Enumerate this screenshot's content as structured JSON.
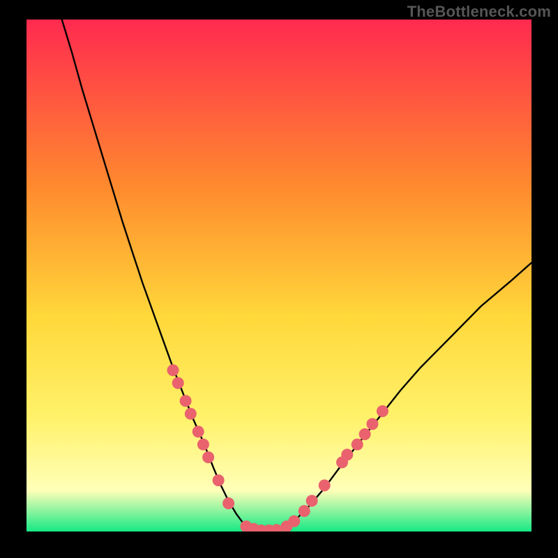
{
  "attribution": "TheBottleneck.com",
  "colors": {
    "gradient_top": "#ff2a4f",
    "gradient_upper_mid": "#ff8b2e",
    "gradient_mid": "#ffd83a",
    "gradient_lower_mid": "#fff26b",
    "gradient_cream": "#ffffb8",
    "gradient_green": "#17e885",
    "curve": "#000000",
    "dot": "#e9626e",
    "frame": "#000000"
  },
  "chart_data": {
    "type": "line",
    "title": "",
    "xlabel": "",
    "ylabel": "",
    "xlim": [
      0,
      100
    ],
    "ylim": [
      0,
      100
    ],
    "series": [
      {
        "name": "bottleneck-curve",
        "x": [
          7.0,
          9.0,
          11.0,
          13.0,
          15.0,
          17.0,
          19.0,
          21.0,
          23.0,
          25.0,
          27.0,
          29.0,
          31.0,
          33.0,
          35.0,
          37.0,
          38.5,
          40.0,
          41.5,
          43.0,
          44.5,
          46.0,
          48.0,
          50.0,
          53.0,
          56.0,
          59.0,
          62.0,
          66.0,
          70.0,
          74.0,
          78.0,
          84.0,
          90.0,
          96.0,
          100.0
        ],
        "y": [
          100.0,
          93.5,
          86.5,
          80.0,
          73.5,
          67.0,
          60.5,
          54.5,
          48.5,
          43.0,
          37.5,
          32.0,
          27.0,
          22.0,
          17.5,
          12.5,
          9.0,
          6.0,
          3.5,
          1.5,
          0.5,
          0.2,
          0.2,
          0.5,
          2.0,
          5.0,
          8.5,
          12.5,
          17.5,
          22.5,
          27.5,
          32.0,
          38.0,
          44.0,
          49.0,
          52.5
        ]
      }
    ],
    "scatter_overlay": {
      "name": "highlight-dots",
      "points": [
        {
          "x": 29.0,
          "y": 31.5
        },
        {
          "x": 30.0,
          "y": 29.0
        },
        {
          "x": 31.5,
          "y": 25.5
        },
        {
          "x": 32.5,
          "y": 23.0
        },
        {
          "x": 34.0,
          "y": 19.5
        },
        {
          "x": 35.0,
          "y": 17.0
        },
        {
          "x": 36.0,
          "y": 14.5
        },
        {
          "x": 38.0,
          "y": 10.0
        },
        {
          "x": 40.0,
          "y": 5.5
        },
        {
          "x": 43.5,
          "y": 1.0
        },
        {
          "x": 45.0,
          "y": 0.5
        },
        {
          "x": 46.5,
          "y": 0.2
        },
        {
          "x": 48.0,
          "y": 0.2
        },
        {
          "x": 49.5,
          "y": 0.3
        },
        {
          "x": 51.5,
          "y": 1.0
        },
        {
          "x": 53.0,
          "y": 2.0
        },
        {
          "x": 55.0,
          "y": 4.0
        },
        {
          "x": 56.5,
          "y": 6.0
        },
        {
          "x": 59.0,
          "y": 9.0
        },
        {
          "x": 62.5,
          "y": 13.5
        },
        {
          "x": 63.5,
          "y": 15.0
        },
        {
          "x": 65.5,
          "y": 17.0
        },
        {
          "x": 67.0,
          "y": 19.0
        },
        {
          "x": 68.5,
          "y": 21.0
        },
        {
          "x": 70.5,
          "y": 23.5
        }
      ]
    },
    "grid": false,
    "legend": null
  }
}
